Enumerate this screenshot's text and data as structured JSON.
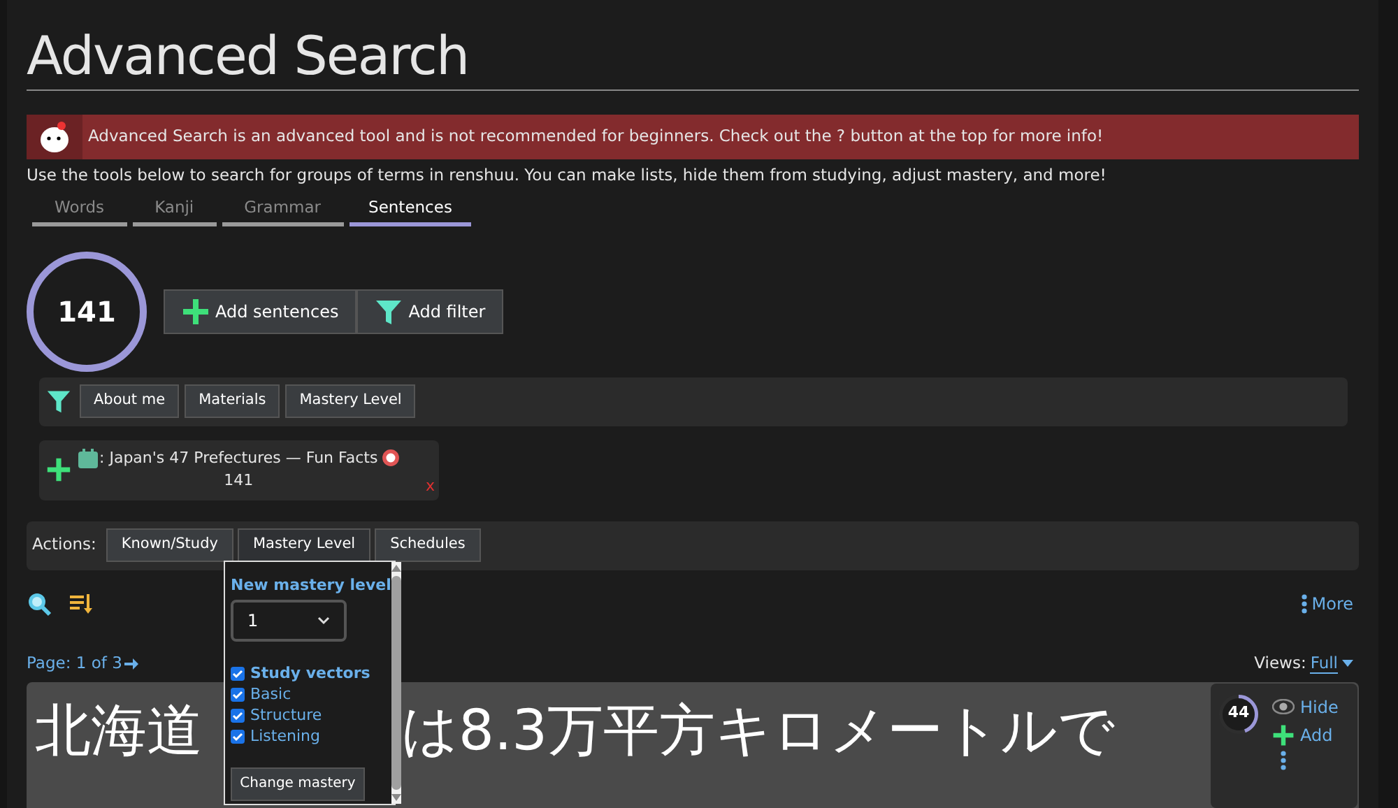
{
  "title": "Advanced Search",
  "warning": {
    "text": "Advanced Search is an advanced tool and is not recommended for beginners. Check out the ? button at the top for more info!"
  },
  "intro": "Use the tools below to search for groups of terms in renshuu. You can make lists, hide them from studying, adjust mastery, and more!",
  "tabs": [
    {
      "label": "Words",
      "selected": false
    },
    {
      "label": "Kanji",
      "selected": false
    },
    {
      "label": "Grammar",
      "selected": false
    },
    {
      "label": "Sentences",
      "selected": true
    }
  ],
  "count": {
    "value": "141",
    "level": 1
  },
  "add_buttons": [
    "Add sentences",
    "Add filter"
  ],
  "filters": [
    "About me",
    "Materials",
    "Mastery Level"
  ],
  "source": {
    "label": ": Japan's 47 Prefectures — Fun Facts",
    "count": "141",
    "remove": "x"
  },
  "actions": {
    "label": "Actions:",
    "buttons": [
      {
        "label": "Known/Study",
        "selected": false
      },
      {
        "label": "Mastery Level",
        "selected": true
      },
      {
        "label": "Schedules",
        "selected": false
      }
    ]
  },
  "popup": {
    "heading": "New mastery level",
    "select_value": "1",
    "vectors": [
      {
        "label": "Study vectors",
        "checked": true,
        "kind": "header"
      },
      {
        "label": "Basic",
        "checked": true,
        "kind": "item"
      },
      {
        "label": "Structure",
        "checked": true,
        "kind": "item"
      },
      {
        "label": "Listening",
        "checked": true,
        "kind": "item"
      }
    ],
    "button": "Change mastery"
  },
  "more": "More",
  "page": "Page: 1 of 3",
  "views": {
    "label": "Views:",
    "value": "Full"
  },
  "sentence": {
    "parts": [
      "北海道",
      "は8.3万平方キロメートルで"
    ],
    "mastery": "44",
    "level": 0.44,
    "hide": "Hide",
    "add": "Add"
  }
}
